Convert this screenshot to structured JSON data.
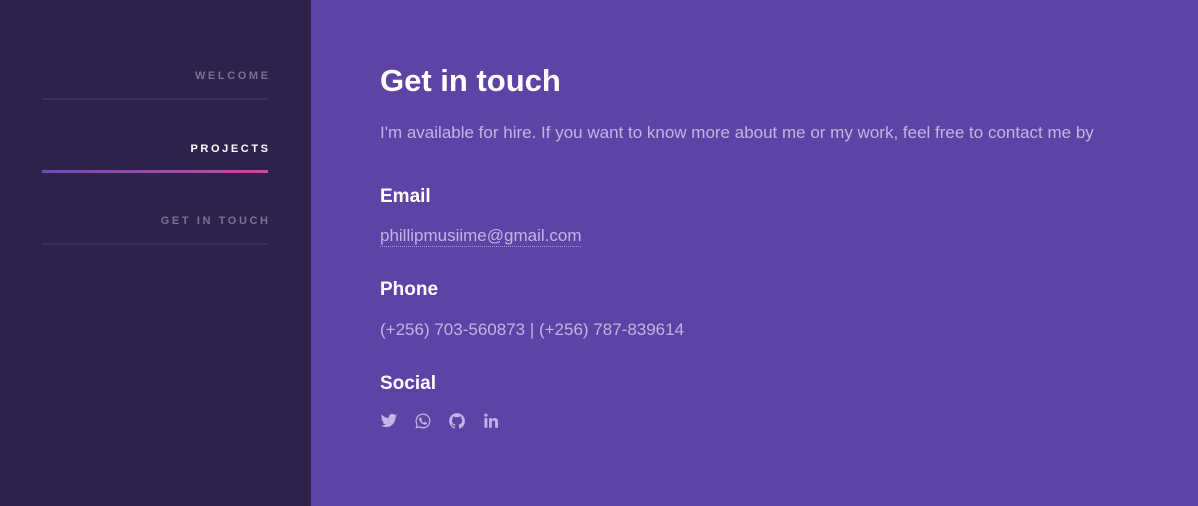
{
  "sidebar": {
    "items": [
      {
        "label": "WELCOME",
        "active": false
      },
      {
        "label": "PROJECTS",
        "active": true
      },
      {
        "label": "GET IN TOUCH",
        "active": false
      }
    ]
  },
  "main": {
    "title": "Get in touch",
    "intro": "I'm available for hire. If you want to know more about me or my work, feel free to contact me by",
    "email": {
      "heading": "Email",
      "value": "phillipmusiime@gmail.com"
    },
    "phone": {
      "heading": "Phone",
      "value": "(+256) 703-560873 | (+256) 787-839614"
    },
    "social": {
      "heading": "Social",
      "icons": [
        "twitter-icon",
        "whatsapp-icon",
        "github-icon",
        "linkedin-icon"
      ]
    }
  },
  "colors": {
    "sidebar_bg": "#2e224c",
    "main_bg": "#5d43a5",
    "muted_text": "#c2b4e4",
    "active_gradient_start": "#6b4bb6",
    "active_gradient_end": "#c24d9a"
  }
}
